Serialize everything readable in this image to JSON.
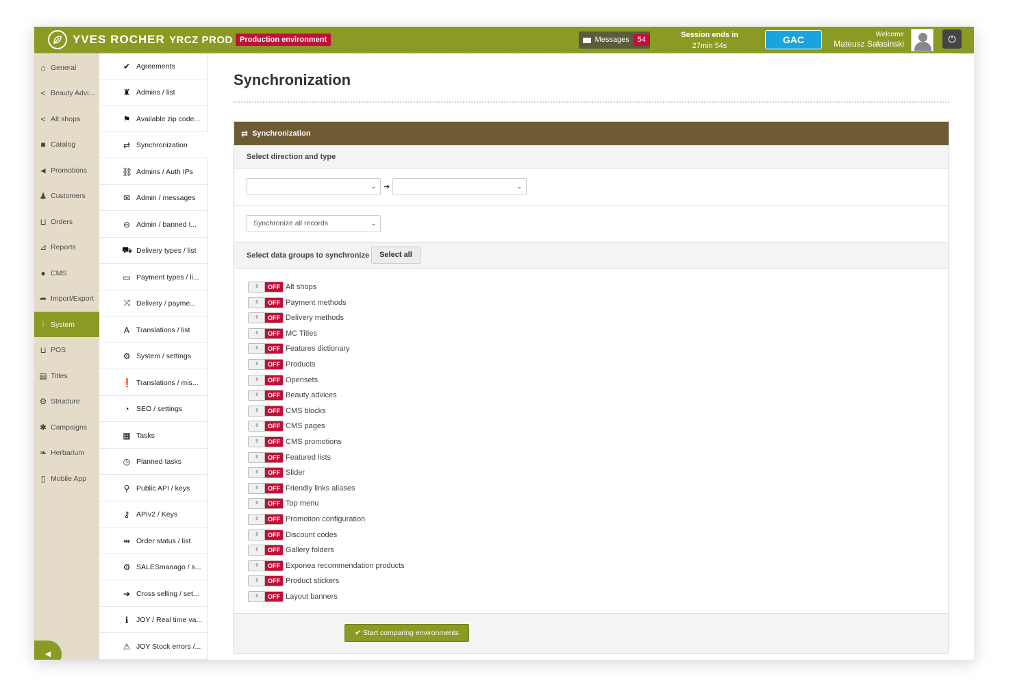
{
  "header": {
    "brand": "YVES ROCHER",
    "env_name": "YRCZ PROD",
    "env_badge": "Production environment",
    "messages_label": "Messages",
    "messages_count": "54",
    "session_label": "Session ends in",
    "session_time": "27min 54s",
    "gac_label": "GAC",
    "welcome_label": "Welcome",
    "user_name": "Mateusz Sałasinski"
  },
  "sidebar": {
    "items": [
      {
        "label": "General",
        "icon": "home-icon"
      },
      {
        "label": "Beauty Advi...",
        "icon": "share-icon"
      },
      {
        "label": "Alt shops",
        "icon": "share-icon"
      },
      {
        "label": "Catalog",
        "icon": "folder-icon"
      },
      {
        "label": "Promotions",
        "icon": "megaphone-icon"
      },
      {
        "label": "Customers",
        "icon": "users-icon"
      },
      {
        "label": "Orders",
        "icon": "cart-icon"
      },
      {
        "label": "Reports",
        "icon": "chart-icon"
      },
      {
        "label": "CMS",
        "icon": "globe-icon"
      },
      {
        "label": "Import/Export",
        "icon": "export-icon"
      },
      {
        "label": "System",
        "icon": "sliders-icon",
        "active": true
      },
      {
        "label": "POS",
        "icon": "cart-icon"
      },
      {
        "label": "Titles",
        "icon": "id-card-icon"
      },
      {
        "label": "Structure",
        "icon": "cogs-icon"
      },
      {
        "label": "Campaigns",
        "icon": "asterisk-icon"
      },
      {
        "label": "Herbarium",
        "icon": "leaf-icon"
      },
      {
        "label": "Mobile App",
        "icon": "mobile-icon"
      }
    ]
  },
  "submenu": {
    "items": [
      {
        "label": "Agreements",
        "icon": "check-icon"
      },
      {
        "label": "Admins / list",
        "icon": "user-tie-icon"
      },
      {
        "label": "Available zip code...",
        "icon": "flag-icon"
      },
      {
        "label": "Synchronization",
        "icon": "sync-icon"
      },
      {
        "label": "Admins / Auth IPs",
        "icon": "link-icon"
      },
      {
        "label": "Admin / messages",
        "icon": "envelope-icon"
      },
      {
        "label": "Admin / banned I...",
        "icon": "ban-icon"
      },
      {
        "label": "Delivery types / list",
        "icon": "truck-icon"
      },
      {
        "label": "Payment types / li...",
        "icon": "money-icon"
      },
      {
        "label": "Delivery / payme...",
        "icon": "shuffle-icon"
      },
      {
        "label": "Translations / list",
        "icon": "font-icon"
      },
      {
        "label": "System / settings",
        "icon": "gear-icon"
      },
      {
        "label": "Translations / mis...",
        "icon": "exclamation-icon"
      },
      {
        "label": "SEO / settings",
        "icon": "dashboard-icon"
      },
      {
        "label": "Tasks",
        "icon": "clipboard-icon"
      },
      {
        "label": "Planned tasks",
        "icon": "clock-icon"
      },
      {
        "label": "Public API / keys",
        "icon": "key-search-icon"
      },
      {
        "label": "APIv2 / Keys",
        "icon": "key-icon"
      },
      {
        "label": "Order status / list",
        "icon": "signpost-icon"
      },
      {
        "label": "SALESmanago / s...",
        "icon": "gear-icon"
      },
      {
        "label": "Cross selling / set...",
        "icon": "arrow-right-icon"
      },
      {
        "label": "JOY / Real time va...",
        "icon": "info-icon"
      },
      {
        "label": "JOY Stock errors /...",
        "icon": "warning-icon"
      }
    ]
  },
  "main": {
    "page_title": "Synchronization",
    "panel_title": "Synchronization",
    "direction_label": "Select direction and type",
    "source_select": "",
    "target_select": "",
    "mode_select": "Synchronize all records",
    "groups_label": "Select data groups to synchronize",
    "select_all": "Select all",
    "toggle_off_label": "OFF",
    "toggle_knob": "III",
    "groups": [
      "Alt shops",
      "Payment methods",
      "Delivery methods",
      "MC Titles",
      "Features dictionary",
      "Products",
      "Opensets",
      "Beauty advices",
      "CMS blocks",
      "CMS pages",
      "CMS promotions",
      "Featured lists",
      "Slider",
      "Friendly links aliases",
      "Top menu",
      "Promotion configuration",
      "Discount codes",
      "Gallery folders",
      "Exponea recommendation products",
      "Product stickers",
      "Layout banners"
    ],
    "start_button": "Start comparing environments"
  },
  "colors": {
    "brand_green": "#8b9a23",
    "sidebar_beige": "#e4dcc8",
    "panel_brown": "#6e5a33",
    "off_red": "#c0103a",
    "gac_blue": "#1aa3dc"
  }
}
